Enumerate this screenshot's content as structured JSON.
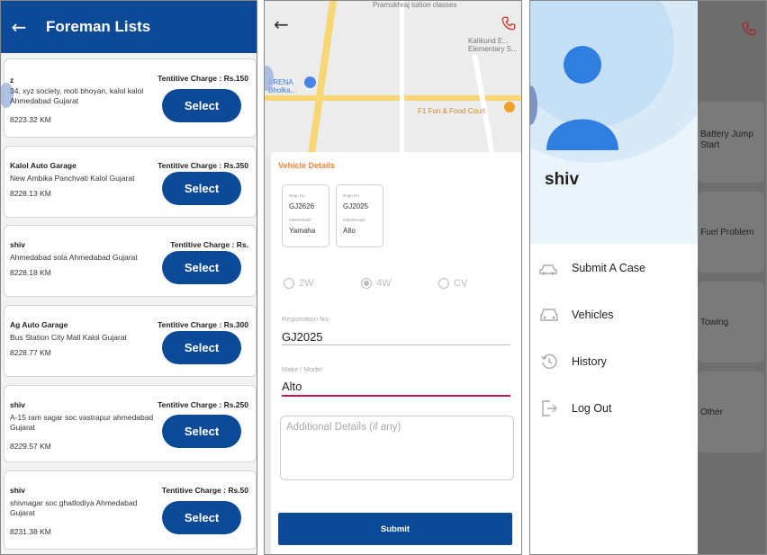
{
  "foreman_list": {
    "title": "Foreman Lists",
    "back_icon": "arrow-left-icon",
    "items": [
      {
        "name": "z",
        "charge": "Tentitive Charge : Rs.150",
        "address": "34, xyz society, moti bhoyan, kalol kalol Ahmedabad Gujarat",
        "distance": "8223.32 KM",
        "button": "Select"
      },
      {
        "name": "Kalol Auto Garage",
        "charge": "Tentitive Charge : Rs.350",
        "address": "New Ambika Panchvati Kalol Gujarat",
        "distance": "8228.13 KM",
        "button": "Select"
      },
      {
        "name": "shiv",
        "charge": "Tentitive Charge : Rs.",
        "address": "Ahmedabad sola Ahmedabad Gujarat",
        "distance": "8228.18 KM",
        "button": "Select"
      },
      {
        "name": "Ag Auto Garage",
        "charge": "Tentitive Charge : Rs.300",
        "address": "Bus Station City Mall Kalol Gujarat",
        "distance": "8228.77 KM",
        "button": "Select"
      },
      {
        "name": "shiv",
        "charge": "Tentitive Charge : Rs.250",
        "address": "A-15 ram sagar soc vastrapur ahmedabad Gujarat",
        "distance": "8229.57 KM",
        "button": "Select"
      },
      {
        "name": "shiv",
        "charge": "Tentitive Charge : Rs.50",
        "address": "shivnagar soc ghatlodiya Ahmedabad Gujarat",
        "distance": "8231.38 KM",
        "button": "Select"
      }
    ]
  },
  "vehicle_form": {
    "map_labels": {
      "top": "Pramukhraj tuition classes",
      "school": "Kalikund E... Elementary S...",
      "arena": "ARENA Bholka...",
      "food": "F1 Fun & Food Court"
    },
    "section_title": "Vehicle Details",
    "vehicles": [
      {
        "reg_label": "Regn No.",
        "reg": "GJ2626",
        "make_label": "Make/Model",
        "make": "Yamaha"
      },
      {
        "reg_label": "Regn No.",
        "reg": "GJ2025",
        "make_label": "Make/Model",
        "make": "Alto"
      }
    ],
    "types": [
      "2W",
      "4W",
      "CV"
    ],
    "selected_type": "4W",
    "registration_label": "Registration No",
    "registration_value": "GJ2025",
    "make_label": "Make / Model",
    "make_value": "Alto",
    "details_placeholder": "Additional Details (if any)",
    "submit_label": "Submit",
    "accent_color": "#e8863a",
    "primary_color": "#0c4a98"
  },
  "drawer": {
    "user_name": "shiv",
    "menu": [
      {
        "label": "Submit A Case",
        "icon": "car-crash-icon"
      },
      {
        "label": "Vehicles",
        "icon": "car-icon"
      },
      {
        "label": "History",
        "icon": "history-icon"
      },
      {
        "label": "Log Out",
        "icon": "logout-icon"
      }
    ],
    "background_items": [
      "Battery Jump Start",
      "Fuel Problem",
      "Towing",
      "Other"
    ]
  }
}
